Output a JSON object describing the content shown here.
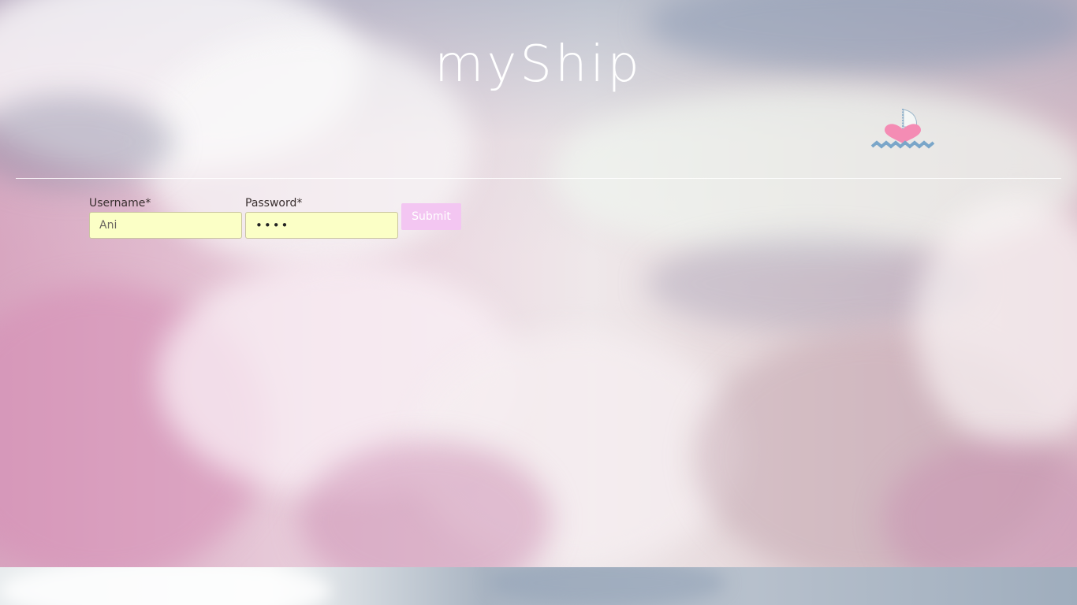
{
  "header": {
    "brand": "myShip",
    "logo_icon": "heart-sailboat-icon"
  },
  "login_form": {
    "username_label": "Username*",
    "username_value": "Ani",
    "password_label": "Password*",
    "password_value": "••••",
    "submit_label": "Submit"
  },
  "colors": {
    "input_background": "#fbffc6",
    "submit_background": "#f3c6f2",
    "brand_text": "#ffffff",
    "logo_heart": "#f48cb4",
    "logo_waves": "#7aa6c9"
  }
}
